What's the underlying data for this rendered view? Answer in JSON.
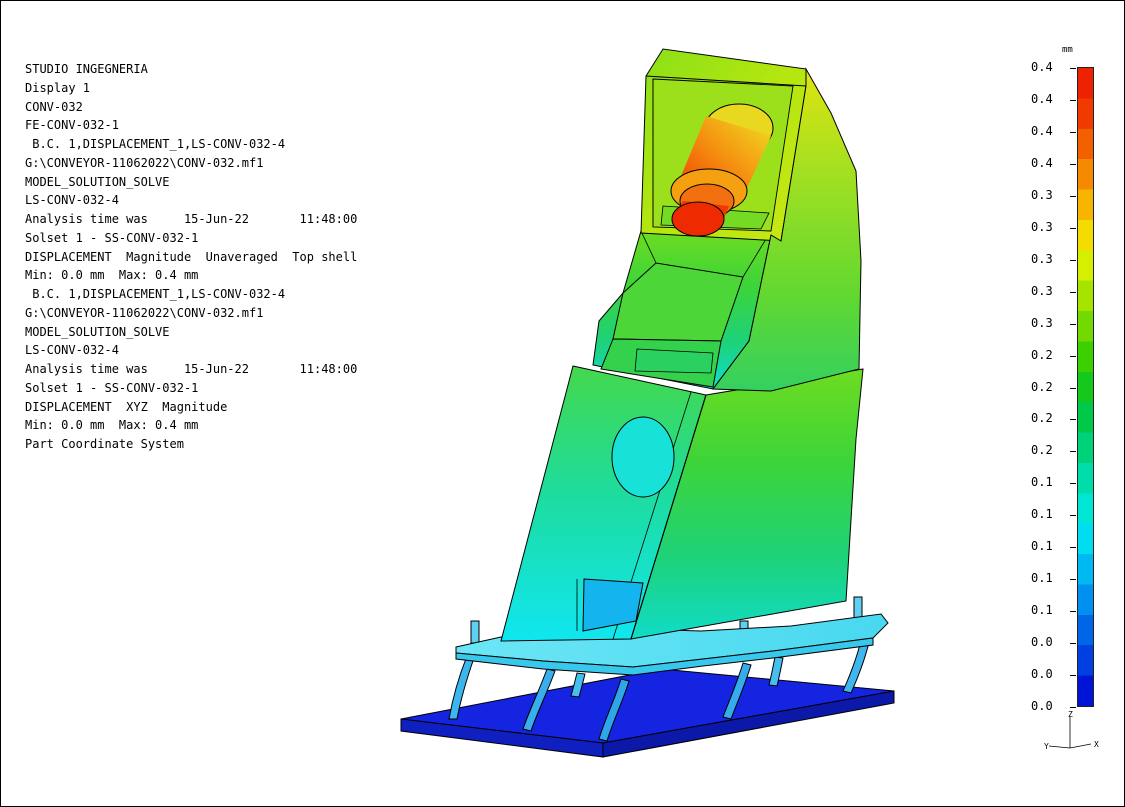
{
  "header_lines": [
    "STUDIO INGEGNERIA",
    "Display 1",
    "CONV-032",
    "FE-CONV-032-1",
    " B.C. 1,DISPLACEMENT_1,LS-CONV-032-4",
    "G:\\CONVEYOR-11062022\\CONV-032.mf1",
    "MODEL_SOLUTION_SOLVE",
    "LS-CONV-032-4",
    "Analysis time was     15-Jun-22       11:48:00",
    "Solset 1 - SS-CONV-032-1",
    "DISPLACEMENT  Magnitude  Unaveraged  Top shell",
    "Min: 0.0 mm  Max: 0.4 mm",
    " B.C. 1,DISPLACEMENT_1,LS-CONV-032-4",
    "G:\\CONVEYOR-11062022\\CONV-032.mf1",
    "MODEL_SOLUTION_SOLVE",
    "LS-CONV-032-4",
    "Analysis time was     15-Jun-22       11:48:00",
    "Solset 1 - SS-CONV-032-1",
    "DISPLACEMENT  XYZ  Magnitude",
    "Min: 0.0 mm  Max: 0.4 mm",
    "Part Coordinate System"
  ],
  "legend": {
    "unit": "mm",
    "tick_labels": [
      "0.4",
      "0.4",
      "0.4",
      "0.4",
      "0.3",
      "0.3",
      "0.3",
      "0.3",
      "0.3",
      "0.2",
      "0.2",
      "0.2",
      "0.2",
      "0.1",
      "0.1",
      "0.1",
      "0.1",
      "0.1",
      "0.0",
      "0.0",
      "0.0"
    ],
    "colors_top_to_bottom": [
      "#ee2200",
      "#f03a00",
      "#f26000",
      "#f58a00",
      "#f7b400",
      "#f5dc00",
      "#d6ee00",
      "#a6e400",
      "#72da00",
      "#3cd000",
      "#14c81c",
      "#00c848",
      "#00d27a",
      "#00dcaa",
      "#00e6d4",
      "#00dcf0",
      "#00b8f2",
      "#0090f0",
      "#0066e8",
      "#0040e0",
      "#0014d8"
    ]
  },
  "triad": {
    "z": "Z",
    "y": "Y",
    "x": "X"
  },
  "colors": {
    "base_plate": "#1424e0",
    "max_displacement": "#ee2200",
    "min_displacement": "#0014d8"
  }
}
